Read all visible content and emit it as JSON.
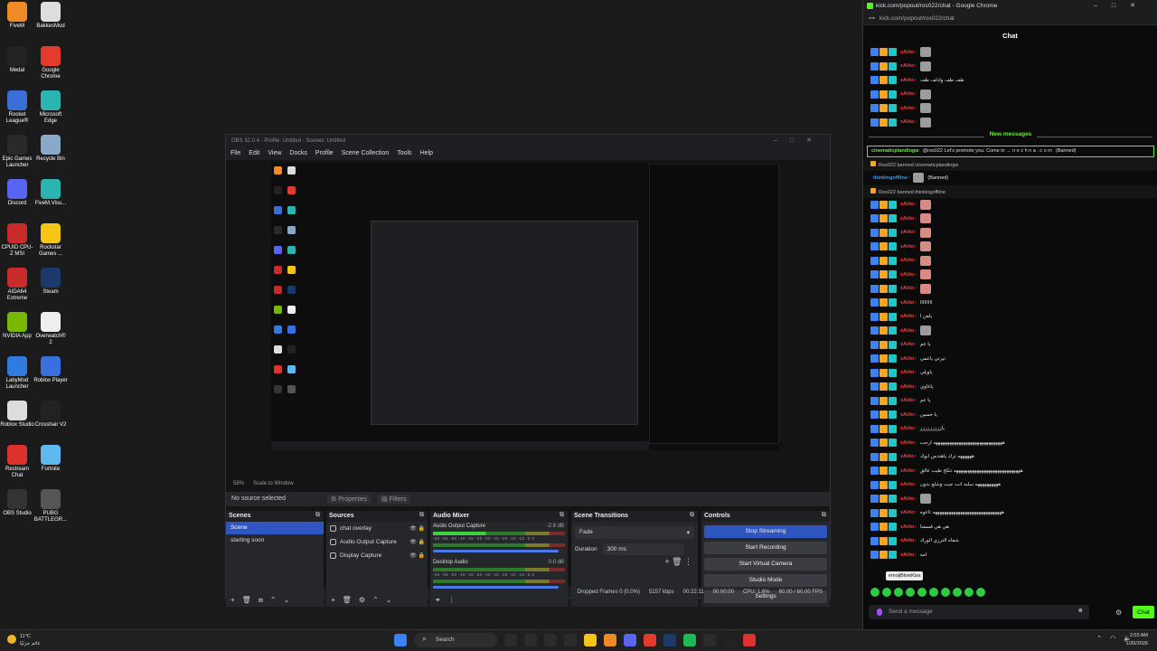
{
  "desktop_icons": [
    {
      "label": "FiveM",
      "color": "#f08a24"
    },
    {
      "label": "BakkesMod",
      "color": "#dddddd"
    },
    {
      "label": "Medal",
      "color": "#222222"
    },
    {
      "label": "Google Chrome",
      "color": "#e33b2e"
    },
    {
      "label": "Rocket League®",
      "color": "#3a6fd8"
    },
    {
      "label": "Microsoft Edge",
      "color": "#2cb5b0"
    },
    {
      "label": "Epic Games Launcher",
      "color": "#2a2a2a"
    },
    {
      "label": "Recycle Bin",
      "color": "#8aa8c8"
    },
    {
      "label": "Discord",
      "color": "#5865f2"
    },
    {
      "label": "FiveM.Visu...",
      "color": "#2cb5b0"
    },
    {
      "label": "CPUID CPU-Z MSI",
      "color": "#c92b2b"
    },
    {
      "label": "Rockstar Games ...",
      "color": "#f5c518"
    },
    {
      "label": "AIDA64 Extreme",
      "color": "#c92b2b"
    },
    {
      "label": "Steam",
      "color": "#1b3a6b"
    },
    {
      "label": "NVIDIA App",
      "color": "#76b900"
    },
    {
      "label": "Overwatch® 2",
      "color": "#eeeeee"
    },
    {
      "label": "LabyMod Launcher",
      "color": "#2f7be0"
    },
    {
      "label": "Roblox Player",
      "color": "#3b6fe0"
    },
    {
      "label": "Roblox Studio",
      "color": "#dddddd"
    },
    {
      "label": "Crosshair V2",
      "color": "#222222"
    },
    {
      "label": "Restream Chat",
      "color": "#e0322d"
    },
    {
      "label": "Fortnite",
      "color": "#5fb8f0"
    },
    {
      "label": "OBS Studio",
      "color": "#333333"
    },
    {
      "label": "PUBG BATTLEGR...",
      "color": "#555555"
    }
  ],
  "obs": {
    "title": "OBS 32.0.4 - Profile: Untitled - Scenes: Untitled",
    "menu": [
      "File",
      "Edit",
      "View",
      "Docks",
      "Profile",
      "Scene Collection",
      "Tools",
      "Help"
    ],
    "preview_zoom": "58%",
    "scale_mode": "Scale to Window",
    "no_source": "No source selected",
    "properties_label": "Properties",
    "filters_label": "Filters",
    "scenes_title": "Scenes",
    "scenes": [
      "Scene",
      "starting soon"
    ],
    "sources_title": "Sources",
    "sources": [
      "chat overlay",
      "Audio Output Capture",
      "Display Capture"
    ],
    "mixer_title": "Audio Mixer",
    "mixer_channels": [
      {
        "name": "Audio Output Capture",
        "db": "-2.8 dB"
      },
      {
        "name": "Desktop Audio",
        "db": "0.0 dB"
      }
    ],
    "mixer_ticks": "-60 -55 -50 -45 -40 -35 -30 -25 -20 -15 -10 -5 0",
    "transitions_title": "Scene Transitions",
    "transition": "Fade",
    "duration_label": "Duration",
    "duration_value": "300 ms",
    "controls_title": "Controls",
    "controls": [
      "Stop Streaming",
      "Start Recording",
      "Start Virtual Camera",
      "Studio Mode",
      "Settings"
    ],
    "status": {
      "dropped": "Dropped Frames 0 (0.0%)",
      "bitrate": "5157 kbps",
      "stream_time": "00:22:11",
      "rec_time": "00:00:00",
      "cpu": "CPU: 1.6%",
      "fps": "60.00 / 60.00 FPS"
    }
  },
  "chrome": {
    "title": "kick.com/popout/ros022/chat - Google Chrome",
    "url": "kick.com/popout/ros022/chat",
    "chat_header": "Chat",
    "new_messages_label": "New messages",
    "highlight_user": "cinematicplandingw",
    "highlight_text": "@ros022 Let's promote you. Come in → n e z h n a . c o m",
    "banned_tag": "(Banned)",
    "sys1": "Ros022 banned cinematicplandingw",
    "thinking_user": "thinkingoffline",
    "sys2": "Ros022 banned thinkingoffline",
    "username": "xAiito",
    "messages_before": [
      {
        "type": "emote",
        "text": ""
      },
      {
        "type": "emote",
        "text": ""
      },
      {
        "type": "text",
        "text": "طف طف وادلف طف"
      },
      {
        "type": "emote",
        "text": ""
      },
      {
        "type": "emote",
        "text": ""
      },
      {
        "type": "emote",
        "text": ""
      }
    ],
    "messages_after": [
      {
        "type": "pink",
        "text": ""
      },
      {
        "type": "pink",
        "text": ""
      },
      {
        "type": "pink",
        "text": ""
      },
      {
        "type": "pink",
        "text": ""
      },
      {
        "type": "pink",
        "text": ""
      },
      {
        "type": "pink",
        "text": ""
      },
      {
        "type": "pink",
        "text": ""
      },
      {
        "type": "text",
        "text": "ااااااااا"
      },
      {
        "type": "text",
        "text": "يلعن ا"
      },
      {
        "type": "emote",
        "text": ""
      },
      {
        "type": "text",
        "text": "يا عم"
      },
      {
        "type": "text",
        "text": "تيرتي ياعمي"
      },
      {
        "type": "text",
        "text": "ياويلي"
      },
      {
        "type": "text",
        "text": "ياغاوي"
      },
      {
        "type": "text",
        "text": "يا عم"
      },
      {
        "type": "text",
        "text": "يا حسين"
      },
      {
        "type": "text",
        "text": "ياززززززززز"
      },
      {
        "type": "text",
        "text": "ههههههههههههههههههههههههههههههه ارحب"
      },
      {
        "type": "text",
        "text": "ههههههه ترك ياهندس ابوك"
      },
      {
        "type": "text",
        "text": "هههههههههههههههههههههههههههههه تنكح طيب عالق"
      },
      {
        "type": "text",
        "text": "ههههههههههه سلبه انت جيت وشلع بدون"
      },
      {
        "type": "emote",
        "text": ""
      },
      {
        "type": "text",
        "text": "ههههههههههههههههههههههههههههههه تاعوه"
      },
      {
        "type": "text",
        "text": "هي هي قسمنا"
      },
      {
        "type": "text",
        "text": "شفاه الترزي الورك"
      },
      {
        "type": "text",
        "text": "امه"
      }
    ],
    "tooltip": "emojiBlowKiss",
    "input_placeholder": "Send a message",
    "send_label": "Chat"
  },
  "taskbar": {
    "weather_temp": "11°C",
    "weather_desc": "غائم جزئيًا",
    "search": "Search",
    "time": "2:03 AM",
    "date": "1/20/2026",
    "app_colors": [
      "#2b2b2b",
      "#2b2b2b",
      "#2b2b2b",
      "#2b2b2b",
      "#f5c518",
      "#f08a24",
      "#5865f2",
      "#e33b2e",
      "#1b3a6b",
      "#1db954",
      "#2b2b2b",
      "#222222",
      "#e0322d"
    ]
  },
  "colors": {
    "kick_green": "#53fc18",
    "obs_blue": "#2e55c0",
    "chat_red": "#ff3b3b"
  }
}
